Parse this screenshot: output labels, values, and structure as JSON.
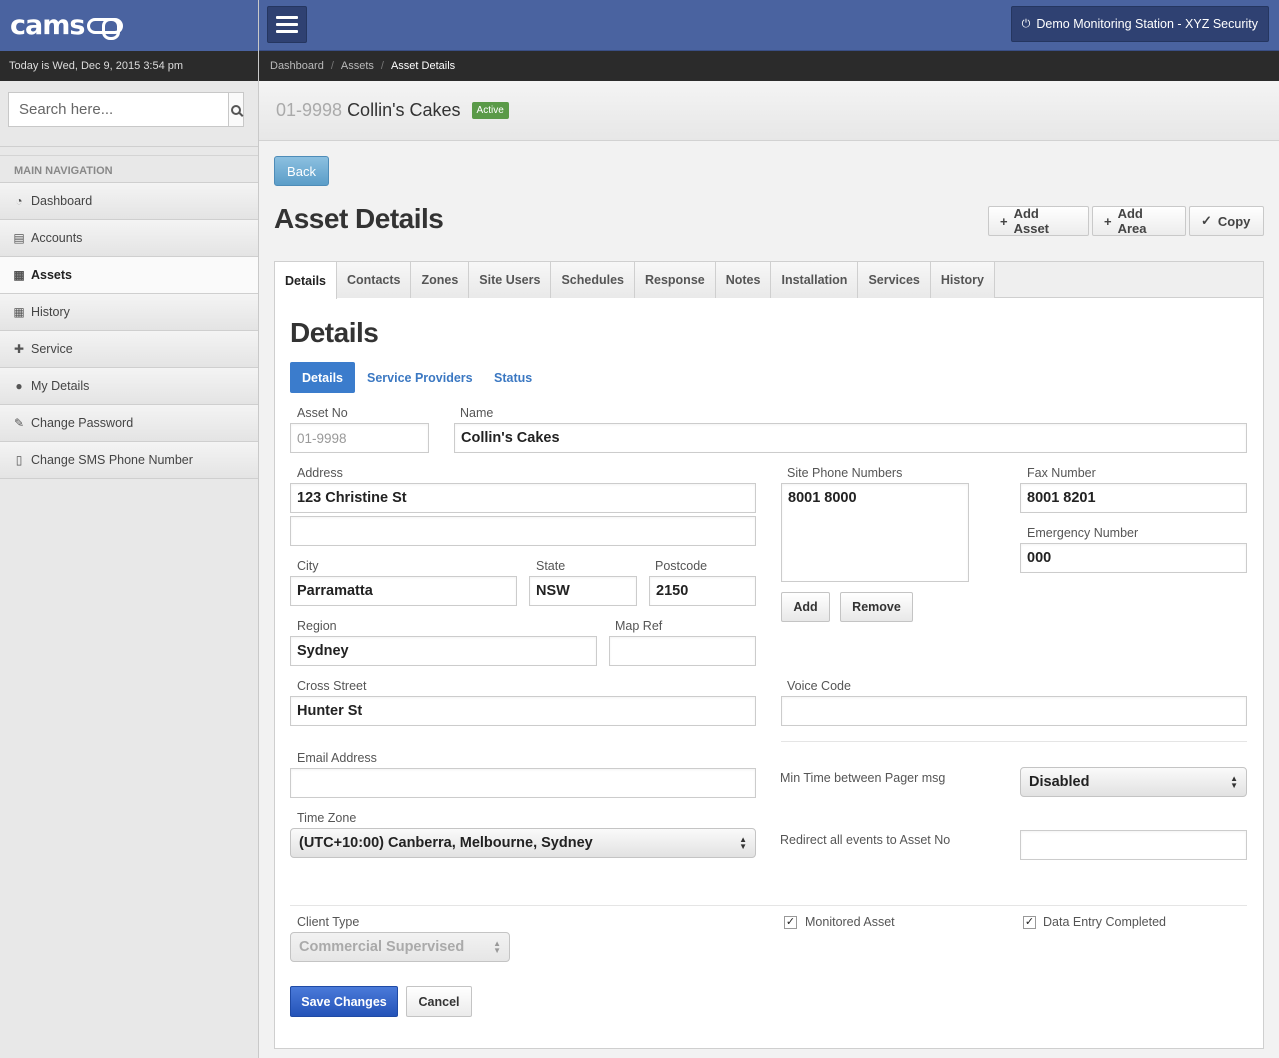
{
  "app": {
    "logo": "cams"
  },
  "date_text": "Today is Wed, Dec 9, 2015 3:54 pm",
  "search": {
    "placeholder": "Search here..."
  },
  "nav": {
    "header": "MAIN NAVIGATION",
    "items": [
      {
        "label": "Dashboard",
        "icon": "dashboard-icon",
        "glyph": "◔"
      },
      {
        "label": "Accounts",
        "icon": "book-icon",
        "glyph": "▤"
      },
      {
        "label": "Assets",
        "icon": "building-icon",
        "glyph": "▦"
      },
      {
        "label": "History",
        "icon": "calendar-icon",
        "glyph": "▦"
      },
      {
        "label": "Service",
        "icon": "medkit-icon",
        "glyph": "✚"
      },
      {
        "label": "My Details",
        "icon": "user-icon",
        "glyph": "●"
      },
      {
        "label": "Change Password",
        "icon": "edit-icon",
        "glyph": "✎"
      },
      {
        "label": "Change SMS Phone Number",
        "icon": "mobile-icon",
        "glyph": "▯"
      }
    ],
    "active": "Assets"
  },
  "header": {
    "station": "Demo Monitoring Station - XYZ Security",
    "station_icon": "power-icon"
  },
  "breadcrumb": {
    "items": [
      "Dashboard",
      "Assets"
    ],
    "current": "Asset Details"
  },
  "asset": {
    "id": "01-9998",
    "name": "Collin's Cakes",
    "status": "Active"
  },
  "main": {
    "back_label": "Back",
    "title": "Asset Details",
    "actions": {
      "add_asset": "Add Asset",
      "add_area": "Add Area",
      "copy": "Copy"
    }
  },
  "tabs": [
    "Details",
    "Contacts",
    "Zones",
    "Site Users",
    "Schedules",
    "Response",
    "Notes",
    "Installation",
    "Services",
    "History"
  ],
  "details": {
    "title": "Details",
    "subtabs": [
      "Details",
      "Service Providers",
      "Status"
    ],
    "labels": {
      "asset_no": "Asset No",
      "name": "Name",
      "address": "Address",
      "city": "City",
      "state": "State",
      "postcode": "Postcode",
      "region": "Region",
      "map_ref": "Map Ref",
      "cross_street": "Cross Street",
      "site_phone": "Site Phone Numbers",
      "fax": "Fax Number",
      "emergency": "Emergency Number",
      "voice_code": "Voice Code",
      "email": "Email Address",
      "time_zone": "Time Zone",
      "min_pager": "Min Time between Pager msg",
      "redirect": "Redirect all events to Asset No",
      "client_type": "Client Type",
      "monitored": "Monitored Asset",
      "data_entry": "Data Entry Completed"
    },
    "values": {
      "asset_no": "01-9998",
      "name": "Collin's Cakes",
      "address1": "123 Christine St",
      "address2": "",
      "city": "Parramatta",
      "state": "NSW",
      "postcode": "2150",
      "region": "Sydney",
      "map_ref": "",
      "cross_street": "Hunter St",
      "site_phone": "8001 8000",
      "fax": "8001 8201",
      "emergency": "000",
      "voice_code": "",
      "email": "",
      "time_zone": "(UTC+10:00) Canberra, Melbourne, Sydney",
      "min_pager": "Disabled",
      "redirect": "",
      "client_type": "Commercial Supervised",
      "monitored": true,
      "data_entry": true
    },
    "phone_buttons": {
      "add": "Add",
      "remove": "Remove"
    },
    "save_label": "Save Changes",
    "cancel_label": "Cancel"
  }
}
